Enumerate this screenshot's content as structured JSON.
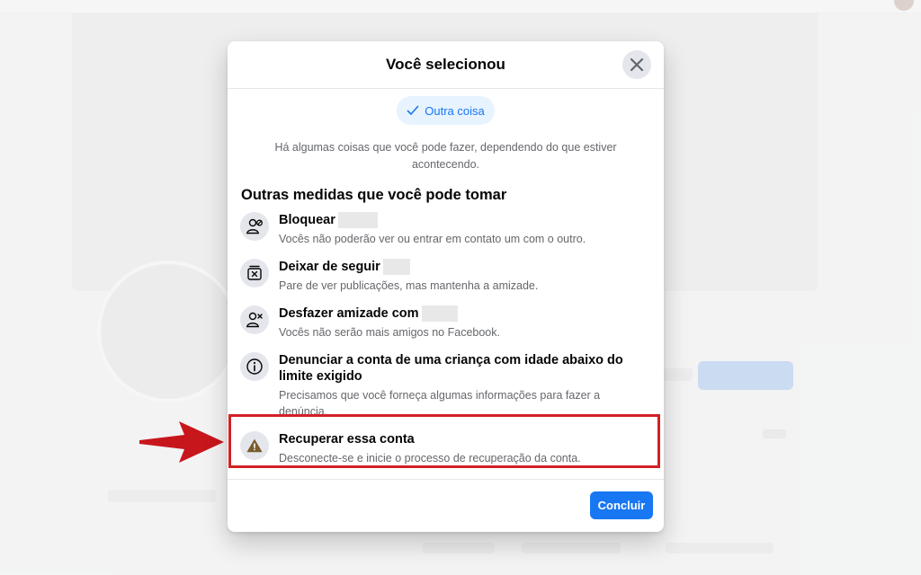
{
  "modal": {
    "title": "Você selecionou",
    "selected_pill": "Outra coisa",
    "intro": "Há algumas coisas que você pode fazer, dependendo do que estiver acontecendo.",
    "section_title": "Outras medidas que você pode tomar",
    "options": [
      {
        "title": "Bloquear",
        "desc": "Vocês não poderão ver ou entrar em contato um com o outro.",
        "icon": "block-user-icon"
      },
      {
        "title": "Deixar de seguir",
        "desc": "Pare de ver publicações, mas mantenha a amizade.",
        "icon": "unfollow-icon"
      },
      {
        "title": "Desfazer amizade com",
        "desc": "Vocês não serão mais amigos no Facebook.",
        "icon": "unfriend-icon"
      },
      {
        "title": "Denunciar a conta de uma criança com idade abaixo do limite exigido",
        "desc": "Precisamos que você forneça algumas informações para fazer a denúncia.",
        "icon": "info-icon"
      },
      {
        "title": "Recuperar essa conta",
        "desc": "Desconecte-se e inicie o processo de recuperação da conta.",
        "icon": "warning-icon"
      }
    ],
    "done_button": "Concluir"
  },
  "colors": {
    "accent": "#1877f2",
    "highlight": "#d32027",
    "arrow": "#c8161d"
  }
}
